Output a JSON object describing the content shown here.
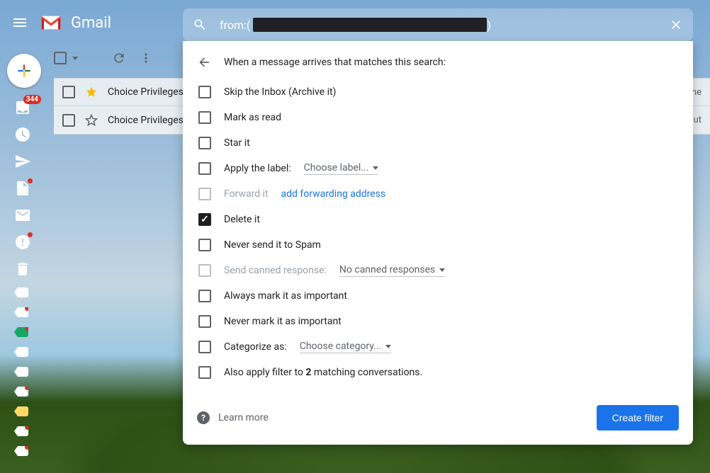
{
  "header": {
    "app_name": "Gmail",
    "search_prefix": "from:(",
    "search_suffix": ")"
  },
  "sidebar": {
    "inbox_badge": "344"
  },
  "emails": [
    {
      "sender": "Choice Privileges",
      "trail": "ame"
    },
    {
      "sender": "Choice Privileges",
      "trail": "t out"
    }
  ],
  "filter": {
    "title": "When a message arrives that matches this search:",
    "options": {
      "skip_inbox": "Skip the Inbox (Archive it)",
      "mark_read": "Mark as read",
      "star_it": "Star it",
      "apply_label": "Apply the label:",
      "apply_label_dd": "Choose label...",
      "forward": "Forward it",
      "forward_link": "add forwarding address",
      "delete": "Delete it",
      "never_spam": "Never send it to Spam",
      "canned": "Send canned response:",
      "canned_dd": "No canned responses",
      "mark_important": "Always mark it as important",
      "never_important": "Never mark it as important",
      "categorize": "Categorize as:",
      "categorize_dd": "Choose category...",
      "also_apply_pre": "Also apply filter to ",
      "also_apply_count": "2",
      "also_apply_post": " matching conversations."
    },
    "learn_more": "Learn more",
    "create": "Create filter"
  }
}
